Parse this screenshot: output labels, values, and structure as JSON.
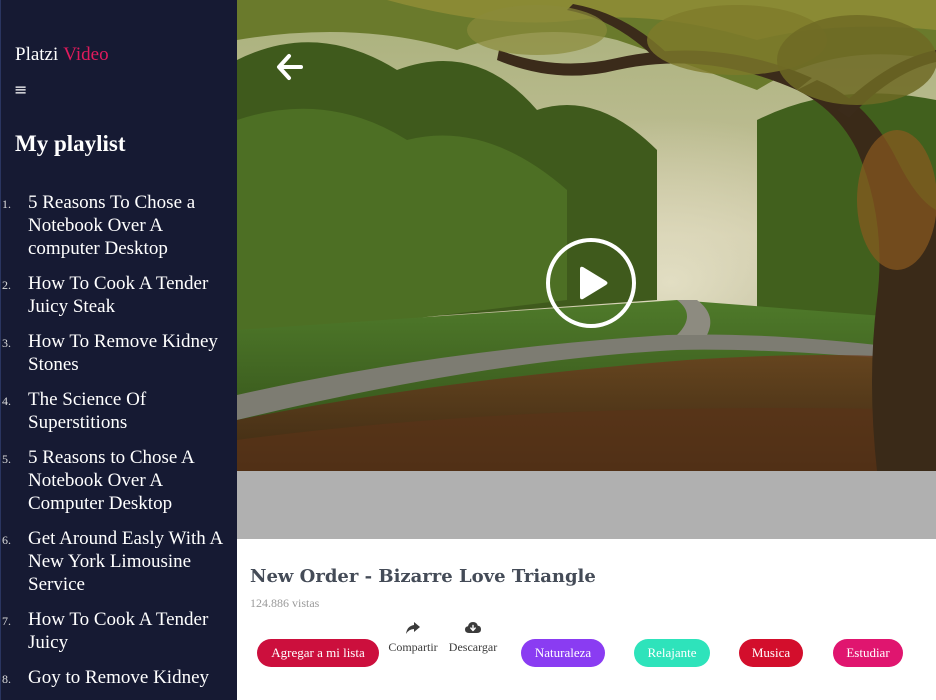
{
  "brand": {
    "first": "Platzi",
    "second": "Video"
  },
  "menu_icon": "hamburger-icon",
  "playlist": {
    "title": "My playlist",
    "items": [
      {
        "num": "1.",
        "title": "5 Reasons To Chose a Notebook Over A computer Desktop"
      },
      {
        "num": "2.",
        "title": "How To Cook A Tender Juicy Steak"
      },
      {
        "num": "3.",
        "title": "How To Remove Kidney Stones"
      },
      {
        "num": "4.",
        "title": "The Science Of Superstitions"
      },
      {
        "num": "5.",
        "title": "5 Reasons to Chose A Notebook Over A Computer Desktop"
      },
      {
        "num": "6.",
        "title": "Get Around Easly With A New York Limousine Service"
      },
      {
        "num": "7.",
        "title": "How To Cook A Tender Juicy"
      },
      {
        "num": "8.",
        "title": "Goy to Remove Kidney"
      }
    ]
  },
  "player": {
    "back_icon": "arrow-left-icon",
    "play_icon": "play-icon"
  },
  "video": {
    "title": "New Order - Bizarre Love Triangle",
    "views": "124.886 vistas"
  },
  "actions": {
    "add_label": "Agregar a mi lista",
    "share_label": "Compartir",
    "download_label": "Descargar"
  },
  "tags": [
    "Naturaleza",
    "Relajante",
    "Musica",
    "Estudiar"
  ],
  "colors": {
    "sidebar_bg": "#161a33",
    "brand_accent": "#e01b5c",
    "add_button": "#cc0f3d",
    "tag_naturaleza": "#8a3cf2",
    "tag_relajante": "#2ee3bb",
    "tag_musica": "#d30e2c",
    "tag_estudiar": "#e0156f"
  }
}
